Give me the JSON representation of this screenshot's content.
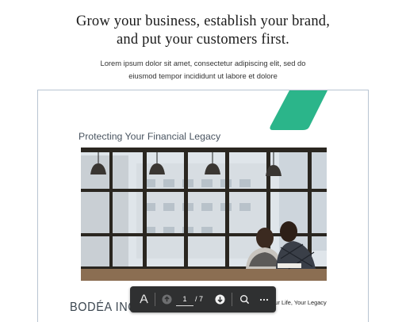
{
  "hero": {
    "title_line1": "Grow your business, establish your brand,",
    "title_line2": "and put your customers first.",
    "subtitle_line1": "Lorem ipsum dolor sit amet, consectetur adipiscing elit, sed do",
    "subtitle_line2": "eiusmod tempor incididunt ut labore et dolore"
  },
  "document": {
    "heading": "Protecting Your Financial Legacy",
    "brand": "BODÉA INC.",
    "footer_tagline": "Your Life, Your Legacy",
    "accent_color": "#2bb58a"
  },
  "toolbar": {
    "current_page": "1",
    "total_pages": "/ 7",
    "icons": [
      "adobe-acrobat-icon",
      "page-up-icon",
      "page-down-icon",
      "search-icon",
      "more-icon"
    ]
  }
}
